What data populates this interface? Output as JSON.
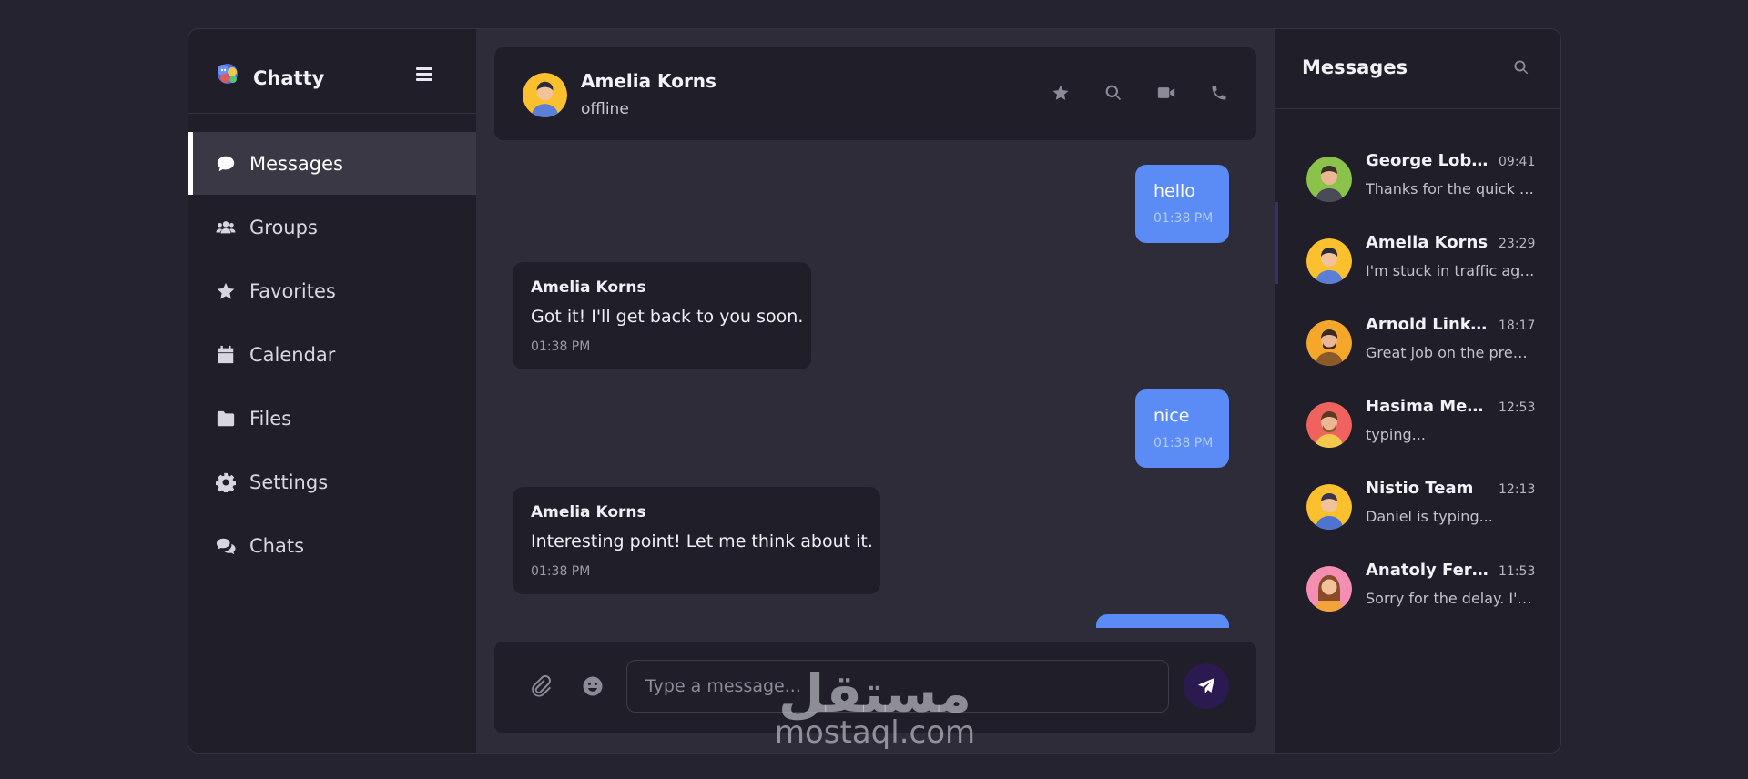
{
  "app": {
    "name": "Chatty"
  },
  "sidebar": {
    "items": [
      {
        "label": "Messages",
        "icon": "comment-icon",
        "active": true
      },
      {
        "label": "Groups",
        "icon": "users-icon",
        "active": false
      },
      {
        "label": "Favorites",
        "icon": "star-icon",
        "active": false
      },
      {
        "label": "Calendar",
        "icon": "calendar-icon",
        "active": false
      },
      {
        "label": "Files",
        "icon": "folder-icon",
        "active": false
      },
      {
        "label": "Settings",
        "icon": "gear-icon",
        "active": false
      },
      {
        "label": "Chats",
        "icon": "chats-icon",
        "active": false
      }
    ]
  },
  "chat": {
    "contact_name": "Amelia Korns",
    "contact_status": "offline",
    "header_icons": [
      "star-icon",
      "search-icon",
      "video-icon",
      "phone-icon"
    ],
    "messages": [
      {
        "direction": "out",
        "text": "hello",
        "time": "01:38 PM"
      },
      {
        "direction": "in",
        "sender": "Amelia Korns",
        "text": "Got it! I'll get back to you soon.",
        "time": "01:38 PM"
      },
      {
        "direction": "out",
        "text": "nice",
        "time": "01:38 PM"
      },
      {
        "direction": "in",
        "sender": "Amelia Korns",
        "text": "Interesting point! Let me think about it.",
        "time": "01:38 PM"
      }
    ],
    "composer": {
      "placeholder": "Type a message..."
    }
  },
  "conversations": {
    "title": "Messages",
    "items": [
      {
        "name": "George Lobko",
        "time": "09:41",
        "preview": "Thanks for the quick response!",
        "avatar_color": "#8bc34a"
      },
      {
        "name": "Amelia Korns",
        "time": "23:29",
        "preview": "I'm stuck in traffic again",
        "avatar_color": "#fbc02d"
      },
      {
        "name": "Arnold Linkeln",
        "time": "18:17",
        "preview": "Great job on the presentation",
        "avatar_color": "#f4a72b"
      },
      {
        "name": "Hasima Medvedeva",
        "time": "12:53",
        "preview": "typing...",
        "avatar_color": "#f0625d"
      },
      {
        "name": "Nistio Team",
        "time": "12:13",
        "preview": "Daniel is typing...",
        "avatar_color": "#fbc02d"
      },
      {
        "name": "Anatoly Ferusso",
        "time": "11:53",
        "preview": "Sorry for the delay. I'll be there soon",
        "avatar_color": "#f48fb1"
      }
    ]
  },
  "watermark": {
    "arabic": "مستقل",
    "latin": "mostaql.com"
  }
}
